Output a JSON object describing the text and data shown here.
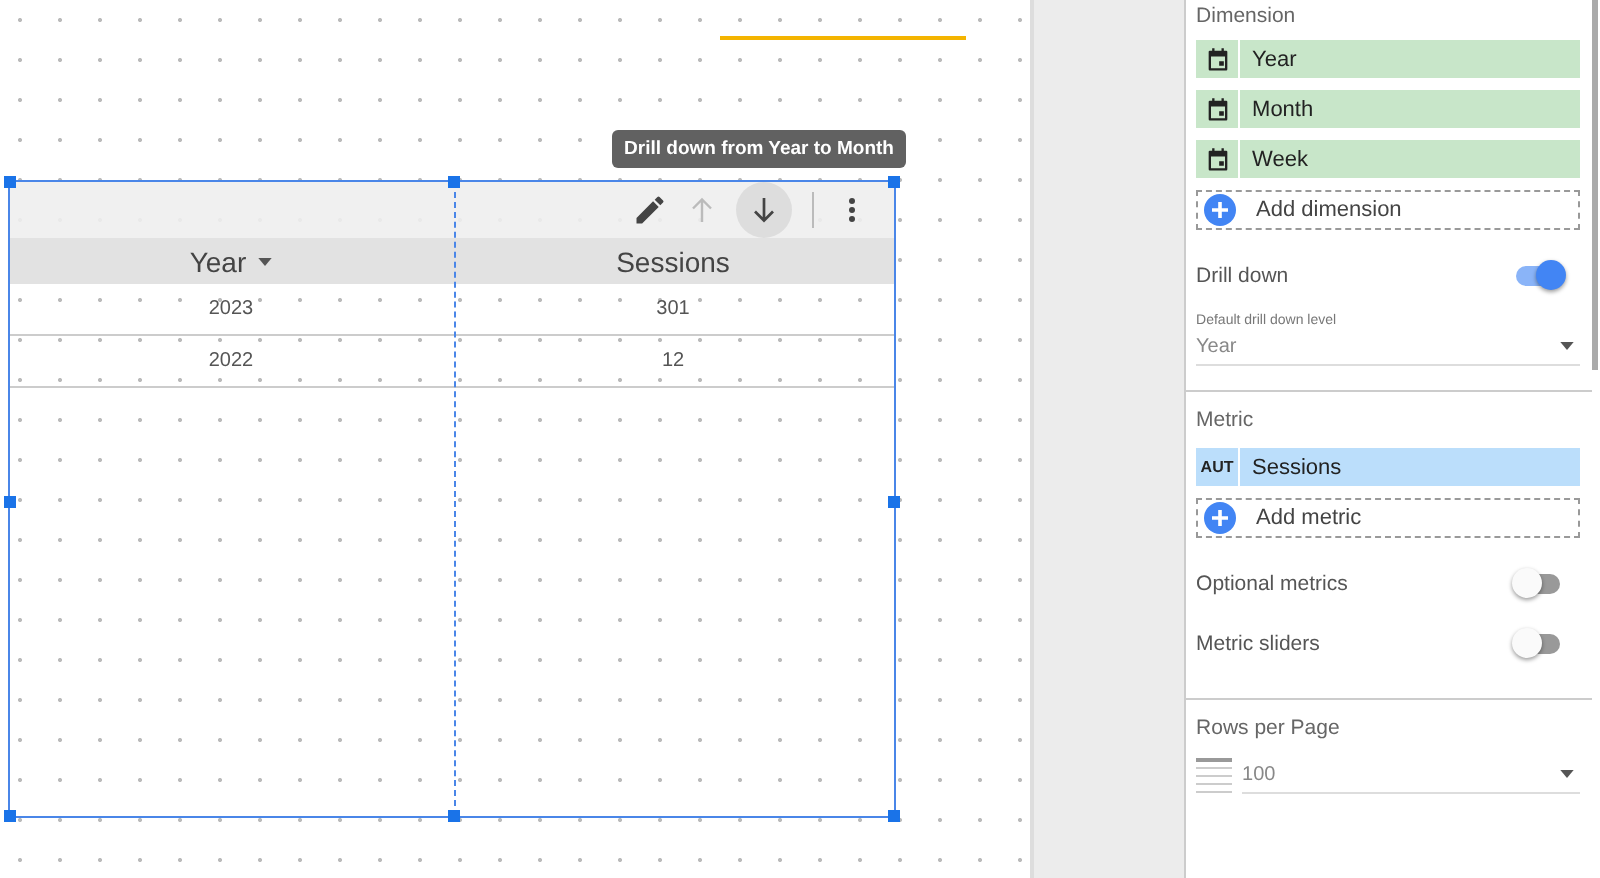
{
  "table": {
    "toolbar": {
      "tooltip": "Drill down from Year to Month",
      "drill_up_disabled": true
    },
    "columns": [
      {
        "label": "Year",
        "sorted": true
      },
      {
        "label": "Sessions",
        "sorted": false
      }
    ],
    "rows": [
      [
        "2023",
        "301"
      ],
      [
        "2022",
        "12"
      ]
    ]
  },
  "panel": {
    "dimension": {
      "title": "Dimension",
      "items": [
        "Year",
        "Month",
        "Week"
      ],
      "add_label": "Add dimension"
    },
    "drill_down": {
      "label": "Drill down",
      "on": true,
      "level_label": "Default drill down level",
      "level_value": "Year"
    },
    "metric": {
      "title": "Metric",
      "items": [
        {
          "badge": "AUT",
          "name": "Sessions"
        }
      ],
      "add_label": "Add metric"
    },
    "toggles": [
      {
        "label": "Optional metrics",
        "on": false
      },
      {
        "label": "Metric sliders",
        "on": false
      }
    ],
    "rows_per_page": {
      "title": "Rows per Page",
      "value": "100"
    }
  }
}
